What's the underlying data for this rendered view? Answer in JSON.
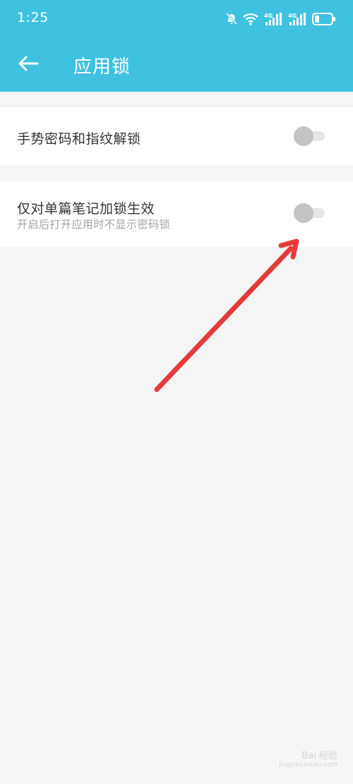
{
  "status_bar": {
    "time": "1:25",
    "icons": [
      "bell-off-icon",
      "wifi-icon",
      "signal-4g-icon",
      "signal-4g-icon",
      "battery-icon"
    ],
    "network_label": "4G"
  },
  "header": {
    "title": "应用锁",
    "back_icon": "arrow-left-icon",
    "background": "#3fc2e0"
  },
  "settings": [
    {
      "label": "手势密码和指纹解锁",
      "enabled": false
    },
    {
      "label": "仅对单篇笔记加锁生效",
      "subtitle": "开启后打开应用时不显示密码锁",
      "enabled": false
    }
  ],
  "annotation": {
    "color": "#e53a3a"
  },
  "watermark": {
    "text": "Bai 经验",
    "subtext": "jingyan.baidu.com"
  }
}
